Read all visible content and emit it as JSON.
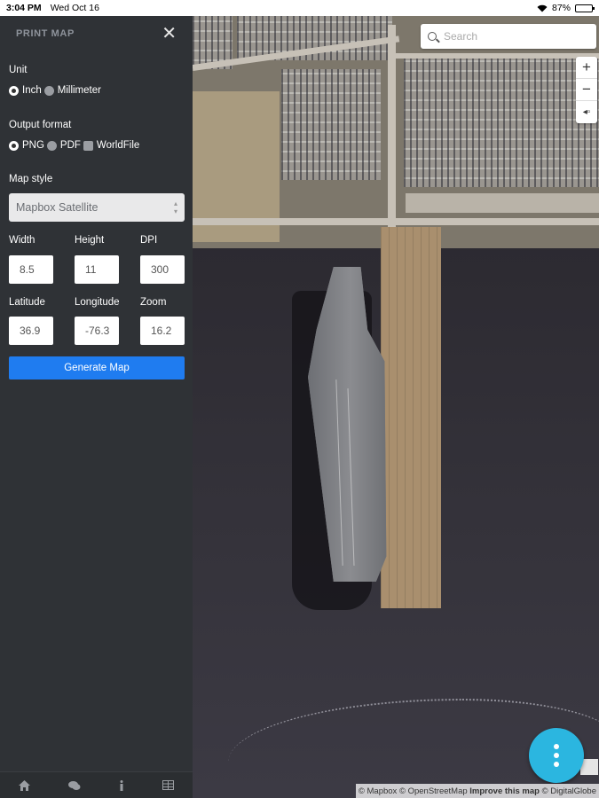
{
  "status_bar": {
    "time": "3:04 PM",
    "date": "Wed Oct 16",
    "battery": "87%",
    "battery_level": 0.87
  },
  "panel": {
    "title": "PRINT MAP",
    "close_icon": "close-icon",
    "unit": {
      "label": "Unit",
      "options": [
        "Inch",
        "Millimeter"
      ],
      "selected": "Inch"
    },
    "output_format": {
      "label": "Output format",
      "options": [
        "PNG",
        "PDF",
        "WorldFile"
      ],
      "selected": "PNG",
      "worldfile_checked": false
    },
    "map_style": {
      "label": "Map style",
      "value": "Mapbox Satellite"
    },
    "width": {
      "label": "Width",
      "value": "8.5"
    },
    "height": {
      "label": "Height",
      "value": "11"
    },
    "dpi": {
      "label": "DPI",
      "value": "300"
    },
    "latitude": {
      "label": "Latitude",
      "value": "36.9"
    },
    "longitude": {
      "label": "Longitude",
      "value": "-76.3"
    },
    "zoom": {
      "label": "Zoom",
      "value": "16.2"
    },
    "generate_label": "Generate Map",
    "bottom_icons": [
      "home-icon",
      "chat-icon",
      "info-icon",
      "table-icon"
    ]
  },
  "map": {
    "search_placeholder": "Search",
    "zoom_in": "+",
    "zoom_out": "−",
    "compass": "◂▫",
    "attribution": {
      "mapbox": "© Mapbox",
      "osm": "© OpenStreetMap",
      "improve": "Improve this map",
      "digitalglobe": "© DigitalGlobe"
    }
  },
  "colors": {
    "accent_button": "#1f7cf0",
    "fab": "#2bb6e0",
    "panel_bg": "#2f3236"
  }
}
